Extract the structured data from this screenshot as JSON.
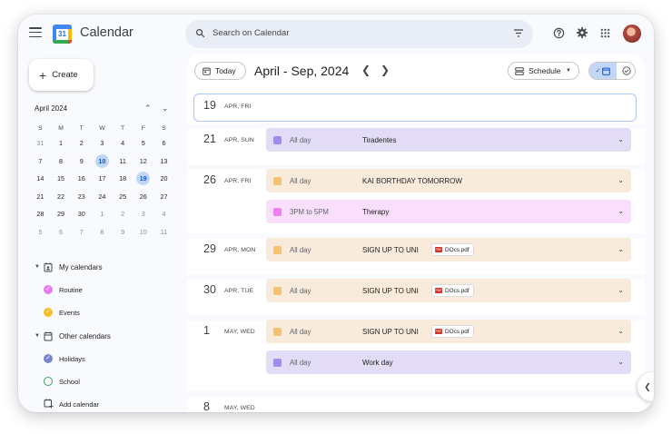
{
  "app": {
    "title": "Calendar",
    "logo_number": "31"
  },
  "search": {
    "placeholder": "Search on Calendar"
  },
  "sidebar": {
    "create_label": "Create",
    "mini_calendar": {
      "month_label": "April 2024",
      "weekdays": [
        "S",
        "M",
        "T",
        "W",
        "T",
        "F",
        "S"
      ],
      "weeks": [
        [
          "31",
          "1",
          "2",
          "3",
          "4",
          "5",
          "6"
        ],
        [
          "7",
          "8",
          "9",
          "10",
          "11",
          "12",
          "13"
        ],
        [
          "14",
          "15",
          "16",
          "17",
          "18",
          "19",
          "20"
        ],
        [
          "21",
          "22",
          "23",
          "24",
          "25",
          "26",
          "27"
        ],
        [
          "28",
          "29",
          "30",
          "1",
          "2",
          "3",
          "4"
        ],
        [
          "5",
          "6",
          "7",
          "8",
          "9",
          "10",
          "11"
        ]
      ]
    },
    "my_calendars": {
      "label": "My calendars",
      "items": [
        {
          "label": "Routine",
          "color": "#e67cf1"
        },
        {
          "label": "Events",
          "color": "#f6bf26"
        }
      ]
    },
    "other_calendars": {
      "label": "Other calendars",
      "items": [
        {
          "label": "Holidays",
          "color": "#7986cb"
        },
        {
          "label": "School",
          "color": "#34a853"
        }
      ]
    },
    "add_calendar_label": "Add calendar"
  },
  "main": {
    "today_label": "Today",
    "date_range": "April - Sep, 2024",
    "view_label": "Schedule",
    "days": [
      {
        "num": "19",
        "label": "APR, FRI",
        "events": []
      },
      {
        "num": "21",
        "label": "APR, SUN",
        "events": [
          {
            "time": "All day",
            "title": "Tiradentes",
            "color": "#e3dcf6",
            "swatch": "#9e8cf3"
          }
        ]
      },
      {
        "num": "26",
        "label": "APR, FRI",
        "events": [
          {
            "time": "All day",
            "title": "KAI BORTHDAY TOMORROW",
            "color": "#f8ebdc",
            "swatch": "#f6c26b"
          },
          {
            "time": "3PM to 5PM",
            "title": "Therapy",
            "color": "#f9dffb",
            "swatch": "#f07ef3"
          }
        ]
      },
      {
        "num": "29",
        "label": "APR, MON",
        "events": [
          {
            "time": "All day",
            "title": "SIGN UP TO UNI",
            "attachment": "DOcs.pdf",
            "color": "#f8ebdc",
            "swatch": "#f6c26b"
          }
        ]
      },
      {
        "num": "30",
        "label": "APR, TUE",
        "events": [
          {
            "time": "All day",
            "title": "SIGN UP TO UNI",
            "attachment": "DOcs.pdf",
            "color": "#f8ebdc",
            "swatch": "#f6c26b"
          }
        ]
      },
      {
        "num": "1",
        "label": "MAY, WED",
        "events": [
          {
            "time": "All day",
            "title": "SIGN UP TO UNI",
            "attachment": "DOcs.pdf",
            "color": "#f8ebdc",
            "swatch": "#f6c26b"
          },
          {
            "time": "All day",
            "title": "Work day",
            "color": "#e3dcf6",
            "swatch": "#9e8cf3"
          }
        ]
      },
      {
        "num": "8",
        "label": "MAY, WED",
        "events": []
      }
    ]
  }
}
